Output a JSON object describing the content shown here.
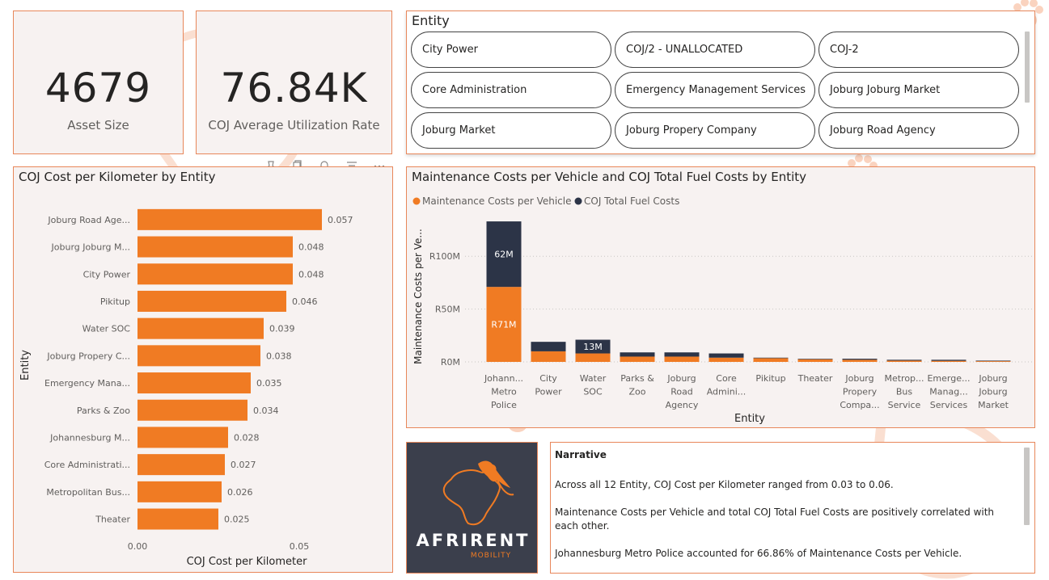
{
  "kpis": [
    {
      "value": "4679",
      "label": "Asset Size"
    },
    {
      "value": "76.84K",
      "label": "COJ Average Utilization Rate"
    }
  ],
  "slicer": {
    "title": "Entity",
    "items": [
      "City Power",
      "COJ/2 - UNALLOCATED",
      "COJ-2",
      "Core Administration",
      "Emergency Management Services",
      "Joburg Joburg Market",
      "Joburg Market",
      "Joburg Propery Company",
      "Joburg Road Agency"
    ]
  },
  "colors": {
    "orange": "#f07b23",
    "navy": "#2c3447",
    "border": "#e8875a",
    "panel_bg": "#f7f2f1"
  },
  "chart_data": [
    {
      "type": "bar",
      "orientation": "horizontal",
      "title": "COJ Cost per Kilometer by Entity",
      "xlabel": "COJ Cost per Kilometer",
      "ylabel": "Entity",
      "categories": [
        "Joburg Road Age...",
        "Joburg Joburg M...",
        "City Power",
        "Pikitup",
        "Water SOC",
        "Joburg Propery C...",
        "Emergency Mana...",
        "Parks & Zoo",
        "Johannesburg M...",
        "Core Administrati...",
        "Metropolitan Bus...",
        "Theater"
      ],
      "values": [
        0.057,
        0.048,
        0.048,
        0.046,
        0.039,
        0.038,
        0.035,
        0.034,
        0.028,
        0.027,
        0.026,
        0.025
      ],
      "data_labels": [
        "0.057",
        "0.048",
        "0.048",
        "0.046",
        "0.039",
        "0.038",
        "0.035",
        "0.034",
        "0.028",
        "0.027",
        "0.026",
        "0.025"
      ],
      "xticks": [
        "0.00",
        "0.05"
      ],
      "xlim": [
        0,
        0.06
      ],
      "color": "#f07b23"
    },
    {
      "type": "bar",
      "stacked": true,
      "title": "Maintenance Costs per Vehicle and COJ Total Fuel Costs by Entity",
      "xlabel": "Entity",
      "ylabel": "Maintenance Costs per Ve...",
      "legend": [
        "Maintenance Costs per Vehicle",
        "COJ Total Fuel Costs"
      ],
      "legend_position": "top-left",
      "categories": [
        [
          "Johann...",
          "Metro",
          "Police"
        ],
        [
          "City",
          "Power"
        ],
        [
          "Water",
          "SOC"
        ],
        [
          "Parks &",
          "Zoo"
        ],
        [
          "Joburg",
          "Road",
          "Agency"
        ],
        [
          "Core",
          "Admini..."
        ],
        [
          "Pikitup"
        ],
        [
          "Theater"
        ],
        [
          "Joburg",
          "Propery",
          "Compa..."
        ],
        [
          "Metrop...",
          "Bus",
          "Service"
        ],
        [
          "Emerge...",
          "Manag...",
          "Services"
        ],
        [
          "Joburg",
          "Joburg",
          "Market"
        ]
      ],
      "series": [
        {
          "name": "Maintenance Costs per Vehicle",
          "color": "#f07b23",
          "values": [
            71,
            10,
            8,
            5,
            5,
            4,
            3.5,
            2.5,
            2,
            1.2,
            1,
            0.7
          ],
          "labels": [
            "R71M",
            "",
            "",
            "",
            "",
            "",
            "",
            "",
            "",
            "",
            "",
            ""
          ]
        },
        {
          "name": "COJ Total Fuel Costs",
          "color": "#2c3447",
          "values": [
            62,
            9,
            13,
            4,
            4,
            4,
            0.5,
            0.5,
            1,
            0.8,
            1,
            0.5
          ],
          "labels": [
            "62M",
            "",
            "13M",
            "",
            "",
            "",
            "",
            "",
            "",
            "",
            "",
            ""
          ]
        }
      ],
      "yticks": [
        "R0M",
        "R50M",
        "R100M"
      ],
      "ylim": [
        0,
        130
      ],
      "grid": true
    }
  ],
  "logo": {
    "name": "AFRIRENT",
    "subtitle": "MOBILITY"
  },
  "narrative": {
    "title": "Narrative",
    "paragraphs": [
      "Across all 12 Entity, COJ Cost per Kilometer ranged from 0.03 to 0.06.",
      "Maintenance Costs per Vehicle and total COJ Total Fuel Costs are positively correlated with each other.",
      "Johannesburg Metro Police accounted for 66.86% of Maintenance Costs per Vehicle."
    ]
  }
}
